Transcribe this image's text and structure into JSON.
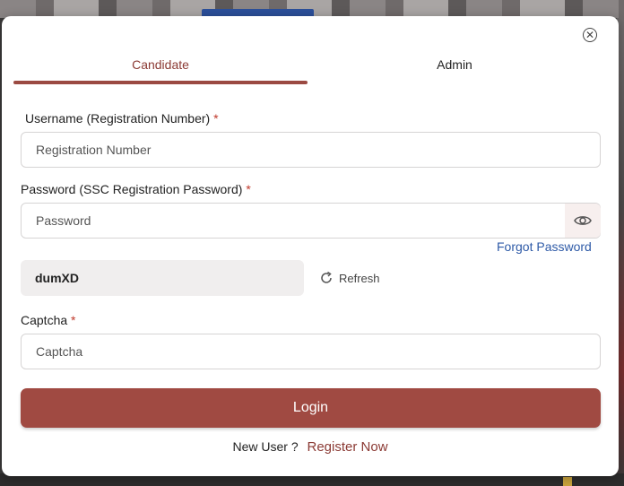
{
  "modal": {
    "tabs": [
      {
        "label": "Candidate",
        "active": true
      },
      {
        "label": "Admin",
        "active": false
      }
    ],
    "close_icon": "close-circle-icon"
  },
  "form": {
    "username": {
      "label": "Username (Registration Number)",
      "required_mark": "*",
      "placeholder": "Registration Number",
      "value": ""
    },
    "password": {
      "label": "Password (SSC Registration Password)",
      "required_mark": "*",
      "placeholder": "Password",
      "value": "",
      "toggle_icon": "eye-icon"
    },
    "forgot_password": "Forgot Password",
    "captcha_image_text": "dumXD",
    "refresh_label": "Refresh",
    "refresh_icon": "refresh-icon",
    "captcha": {
      "label": "Captcha",
      "required_mark": "*",
      "placeholder": "Captcha",
      "value": ""
    },
    "login_label": "Login"
  },
  "footer": {
    "new_user_text": "New User ?",
    "register_label": "Register Now"
  },
  "colors": {
    "accent": "#a04a42",
    "link_blue": "#2e5aa7",
    "required": "#c0392b"
  }
}
